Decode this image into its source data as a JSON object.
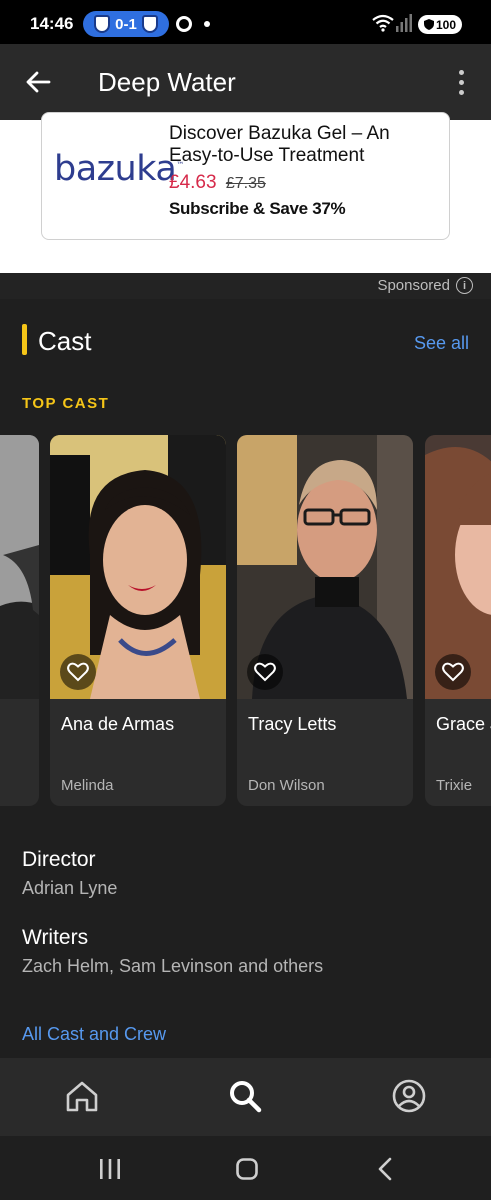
{
  "status_bar": {
    "time": "14:46",
    "score": "0-1",
    "battery": "100"
  },
  "app_bar": {
    "title": "Deep Water"
  },
  "ad": {
    "logo": "bazuka",
    "logo_tm": "™",
    "headline": "Discover Bazuka Gel – An Easy-to-Use Treatment",
    "price_now": "£4.63",
    "price_was": "£7.35",
    "cta": "Subscribe & Save 37%",
    "sponsored_label": "Sponsored"
  },
  "cast": {
    "section_title": "Cast",
    "see_all": "See all",
    "top_cast_label": "TOP CAST",
    "members": [
      {
        "name": "",
        "role": ""
      },
      {
        "name": "Ana de Armas",
        "role": "Melinda"
      },
      {
        "name": "Tracy Letts",
        "role": "Don Wilson"
      },
      {
        "name": "Grace Jenkins",
        "role": "Trixie"
      }
    ]
  },
  "credits": {
    "director_label": "Director",
    "director": "Adrian Lyne",
    "writers_label": "Writers",
    "writers": "Zach Helm, Sam Levinson and others",
    "all_cast_link": "All Cast and Crew"
  },
  "colors": {
    "accent_yellow": "#f5c518",
    "link_blue": "#5799ef",
    "background": "#1f1f1f",
    "card": "#2c2c2c"
  },
  "icons": {
    "nav_home": "home-icon",
    "nav_search": "search-icon",
    "nav_profile": "profile-icon"
  }
}
